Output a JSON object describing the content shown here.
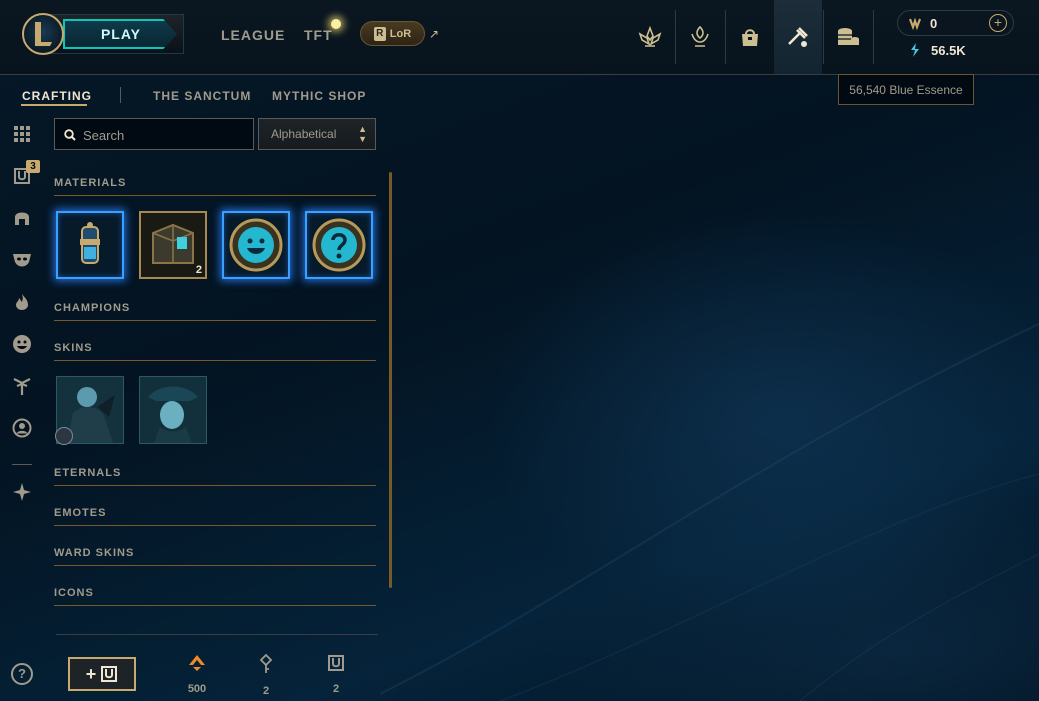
{
  "topbar": {
    "play_label": "PLAY",
    "nav": [
      "LEAGUE",
      "TFT"
    ],
    "lor_label": "LoR",
    "lor_letter": "R",
    "icons": [
      "clash-icon",
      "honor-icon",
      "store-icon",
      "crafting-icon",
      "loot-icon"
    ],
    "active_icon": "crafting-icon"
  },
  "wallet": {
    "rp": "0",
    "blue_essence": "56.5K",
    "add_label": "+"
  },
  "tooltip": "56,540 Blue Essence",
  "subnav": {
    "tabs": [
      "CRAFTING",
      "THE SANCTUM",
      "MYTHIC SHOP"
    ],
    "active": "CRAFTING"
  },
  "left_rail": {
    "chest_badge": "3",
    "icons": [
      "grid-icon",
      "chest-icon",
      "helmet-icon",
      "mask-icon",
      "flame-icon",
      "emote-icon",
      "ward-icon",
      "profile-icon",
      "tft-icon"
    ],
    "help_label": "?"
  },
  "search": {
    "placeholder": "Search",
    "sort_value": "Alphabetical"
  },
  "sections": {
    "materials": "MATERIALS",
    "champions": "CHAMPIONS",
    "skins": "SKINS",
    "eternals": "ETERNALS",
    "emotes": "EMOTES",
    "ward_skins": "WARD SKINS",
    "icons": "ICONS"
  },
  "materials": [
    {
      "name": "capsule",
      "count": ""
    },
    {
      "name": "hextech-chest",
      "count": "2"
    },
    {
      "name": "emote-smile",
      "count": ""
    },
    {
      "name": "mystery-emote",
      "count": ""
    }
  ],
  "skins": [
    {
      "name": "skin-shard-1"
    },
    {
      "name": "skin-shard-2"
    }
  ],
  "footer": {
    "orange_essence": "500",
    "keys": "2",
    "chests": "2"
  },
  "colors": {
    "gold": "#c8aa6e",
    "teal": "#0ac8b9",
    "blue_glow": "#3aa0ff",
    "background": "#010a13"
  }
}
